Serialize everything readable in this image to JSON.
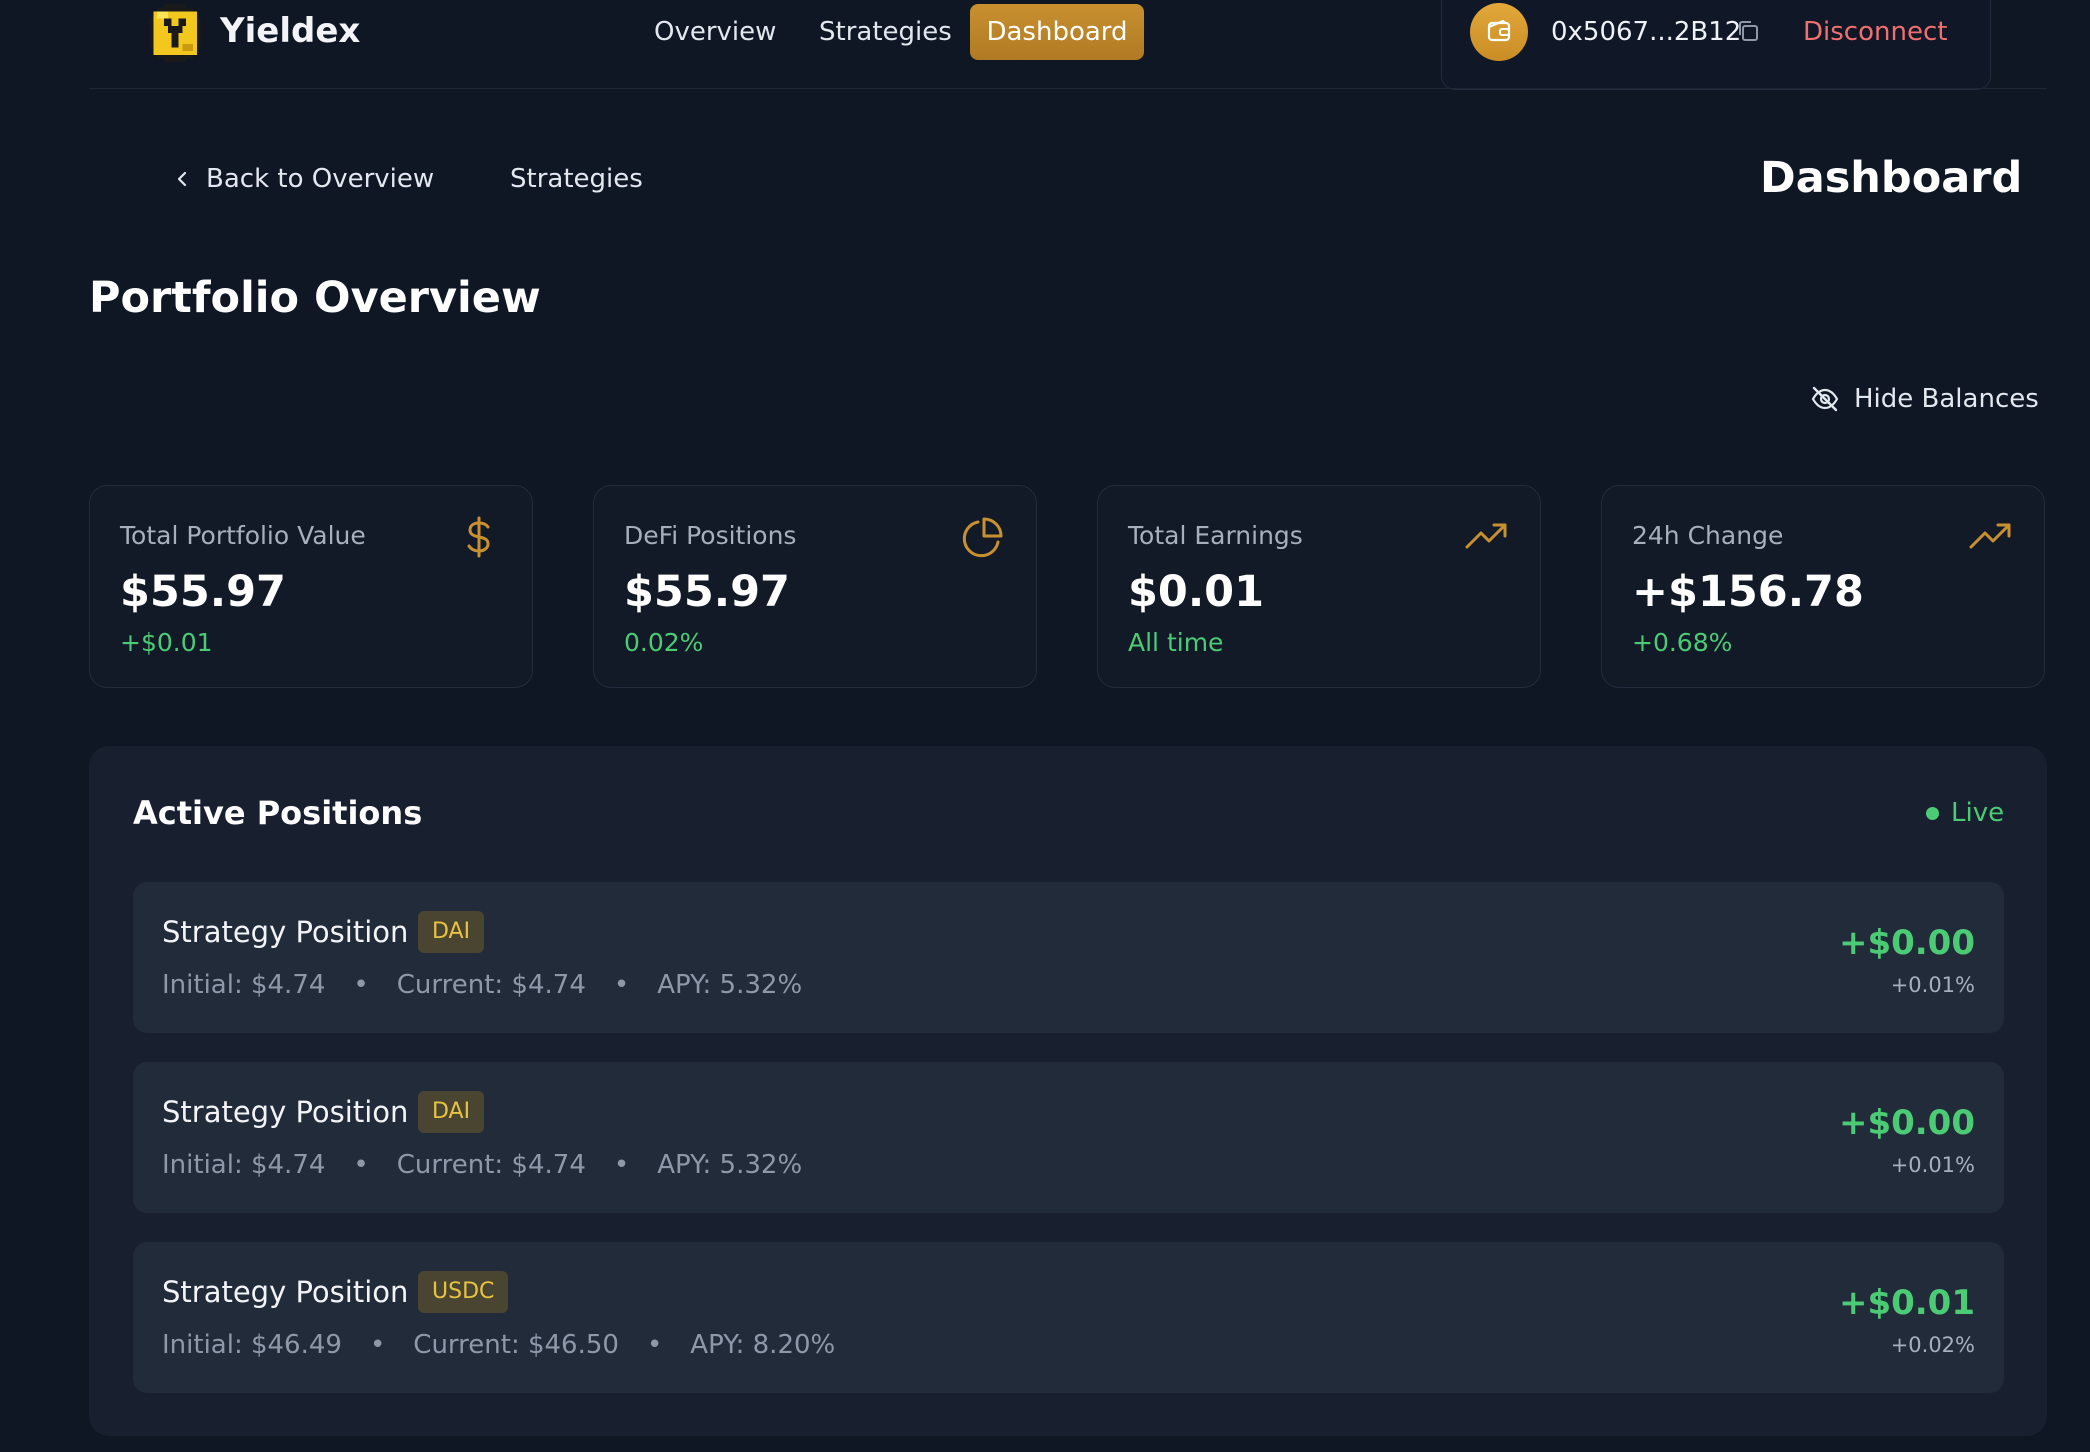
{
  "header": {
    "brand": "Yieldex",
    "nav": {
      "overview": "Overview",
      "strategies": "Strategies",
      "dashboard": "Dashboard"
    },
    "wallet": {
      "address": "0x5067...2B12",
      "disconnect": "Disconnect"
    }
  },
  "subnav": {
    "back": "Back to Overview",
    "strategies": "Strategies",
    "heading": "Dashboard"
  },
  "section_title": "Portfolio Overview",
  "hide_balances": "Hide Balances",
  "stats": [
    {
      "label": "Total Portfolio Value",
      "value": "$55.97",
      "sub": "+$0.01",
      "icon": "dollar-icon"
    },
    {
      "label": "DeFi Positions",
      "value": "$55.97",
      "sub": "0.02%",
      "icon": "pie-chart-icon"
    },
    {
      "label": "Total Earnings",
      "value": "$0.01",
      "sub": "All time",
      "icon": "trending-up-icon"
    },
    {
      "label": "24h Change",
      "value": "+$156.78",
      "sub": "+0.68%",
      "icon": "trending-up-icon"
    }
  ],
  "active_positions": {
    "title": "Active Positions",
    "status": "Live",
    "items": [
      {
        "name": "Strategy Position",
        "token": "DAI",
        "initial": "Initial: $4.74",
        "current": "Current: $4.74",
        "apy": "APY: 5.32%",
        "gain": "+$0.00",
        "pct": "+0.01%"
      },
      {
        "name": "Strategy Position",
        "token": "DAI",
        "initial": "Initial: $4.74",
        "current": "Current: $4.74",
        "apy": "APY: 5.32%",
        "gain": "+$0.00",
        "pct": "+0.01%"
      },
      {
        "name": "Strategy Position",
        "token": "USDC",
        "initial": "Initial: $46.49",
        "current": "Current: $46.50",
        "apy": "APY: 8.20%",
        "gain": "+$0.01",
        "pct": "+0.02%"
      }
    ]
  },
  "colors": {
    "accent": "#c8902f",
    "positive": "#4ccb75",
    "danger": "#f07070",
    "background": "#0f1624"
  }
}
